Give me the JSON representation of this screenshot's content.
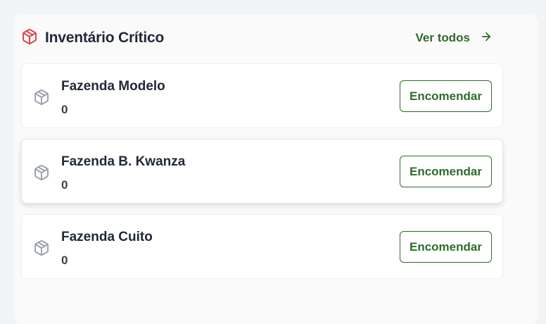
{
  "header": {
    "title": "Inventário Crítico",
    "title_icon": "package-icon",
    "view_all_label": "Ver todos",
    "view_all_icon": "arrow-right-icon"
  },
  "colors": {
    "accent": "#2e6b2b",
    "title_icon": "#e0454f",
    "item_icon": "#9ca3af"
  },
  "items": [
    {
      "name": "Fazenda Modelo",
      "quantity": "0",
      "action_label": "Encomendar",
      "icon": "package-icon"
    },
    {
      "name": "Fazenda B. Kwanza",
      "quantity": "0",
      "action_label": "Encomendar",
      "icon": "package-icon"
    },
    {
      "name": "Fazenda Cuito",
      "quantity": "0",
      "action_label": "Encomendar",
      "icon": "package-icon"
    }
  ]
}
